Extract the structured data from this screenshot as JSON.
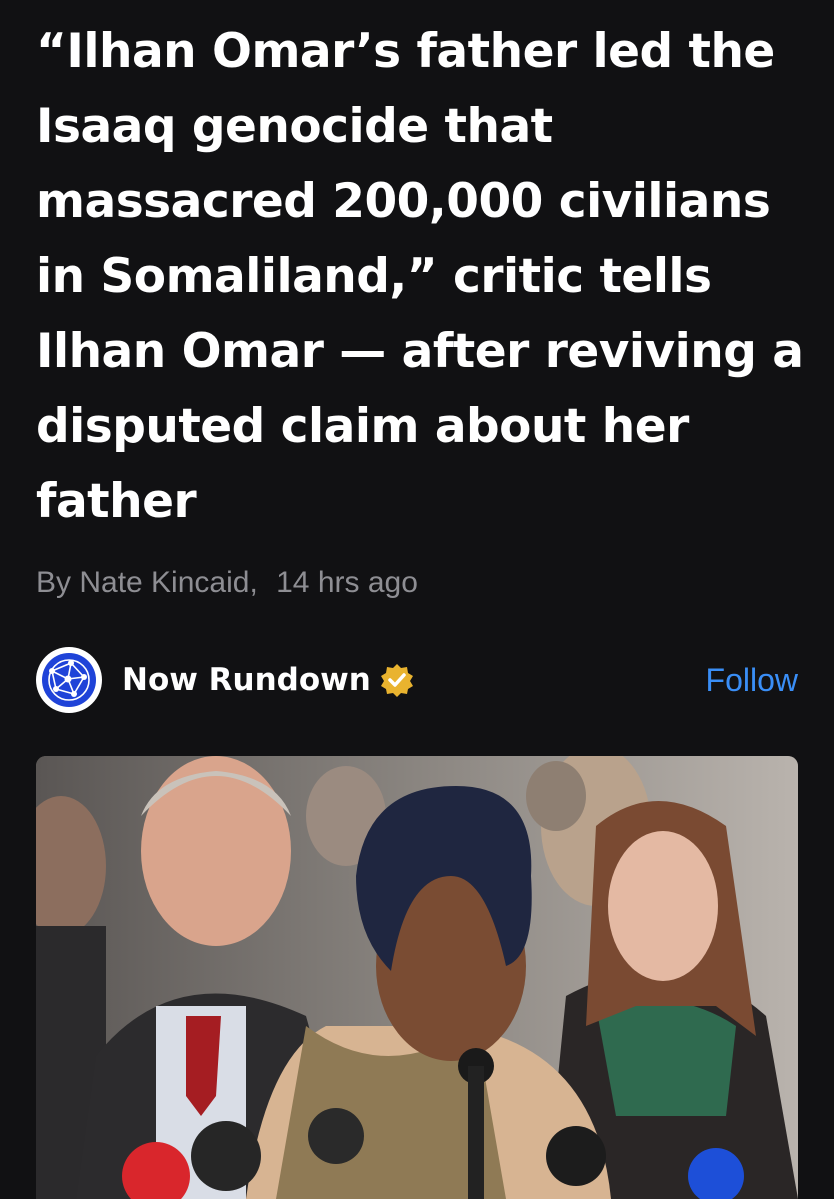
{
  "article": {
    "headline": "“Ilhan Omar’s father led the Isaaq genocide that massacred 200,000 civilians in Somaliland,” critic tells Ilhan Omar — after reviving a disputed claim about her father",
    "byline_author": "By Nate Kincaid,",
    "byline_time": "14 hrs ago"
  },
  "publisher": {
    "name": "Now Rundown",
    "follow_label": "Follow",
    "avatar_icon": "network-globe-icon",
    "verified_icon": "verified-badge-icon",
    "brand_color": "#1f43d8",
    "badge_color": "#e9b32f",
    "follow_color": "#3a8ef6"
  },
  "image": {
    "icon": "news-photo-image"
  }
}
